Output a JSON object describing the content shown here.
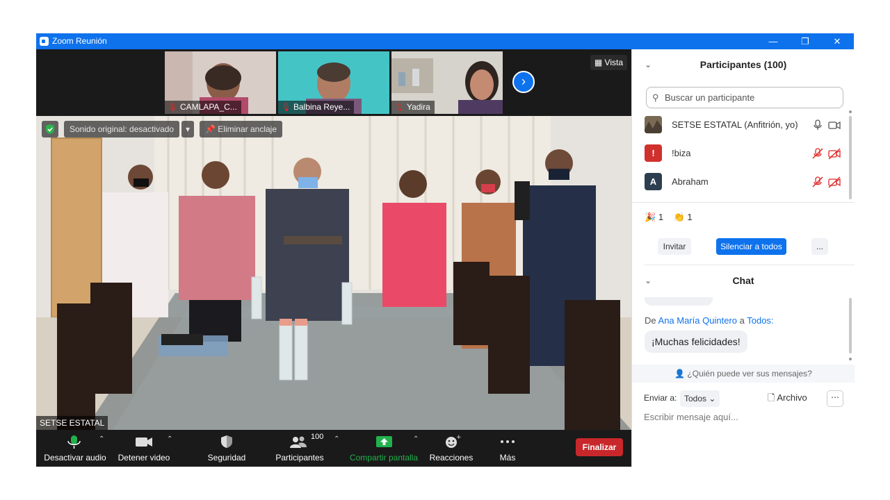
{
  "window": {
    "title": "Zoom Reunión",
    "controls": {
      "minimize": "—",
      "restore": "❐",
      "close": "✕"
    }
  },
  "thumbnails": [
    {
      "name": "CAMLAPA_C..."
    },
    {
      "name": "Balbina Reye..."
    },
    {
      "name": "Yadira"
    }
  ],
  "strip": {
    "view_label": "Vista"
  },
  "main_video": {
    "original_sound_label": "Sonido original: desactivado",
    "unpin_label": "Eliminar anclaje",
    "speaker_name": "SETSE ESTATAL"
  },
  "toolbar": {
    "mute_label": "Desactivar audio",
    "video_label": "Detener video",
    "security_label": "Seguridad",
    "participants_label": "Participantes",
    "participants_count": "100",
    "share_label": "Compartir pantalla",
    "reactions_label": "Reacciones",
    "more_label": "Más",
    "end_label": "Finalizar"
  },
  "participants_panel": {
    "title": "Participantes (100)",
    "search_placeholder": "Buscar un participante",
    "rows": [
      {
        "name": "SETSE ESTATAL (Anfitrión, yo)",
        "avatar": ""
      },
      {
        "name": "!biza",
        "avatar": "!",
        "avatar_color": "#d0312d"
      },
      {
        "name": "Abraham",
        "avatar": "A",
        "avatar_color": "#2d3e50"
      }
    ],
    "reactions": [
      {
        "icon": "party-popper-icon",
        "glyph": "🎉",
        "count": "1"
      },
      {
        "icon": "clap-icon",
        "glyph": "👏",
        "count": "1"
      }
    ],
    "invite_label": "Invitar",
    "mute_all_label": "Silenciar a todos",
    "more_label": "..."
  },
  "chat_panel": {
    "title": "Chat",
    "from_prefix": "De",
    "sender": "Ana María Quintero",
    "to_word": "a",
    "recipient": "Todos:",
    "message": "¡Muchas felicidades!",
    "who_sees": "¿Quién puede ver sus mensajes?",
    "send_to_label": "Enviar a:",
    "send_to_value": "Todos",
    "file_label": "Archivo",
    "input_placeholder": "Escribir mensaje aquí..."
  },
  "colors": {
    "brand_blue": "#0e72ed",
    "end_red": "#c8282b",
    "share_green": "#22b14c",
    "mute_red": "#e02828"
  }
}
